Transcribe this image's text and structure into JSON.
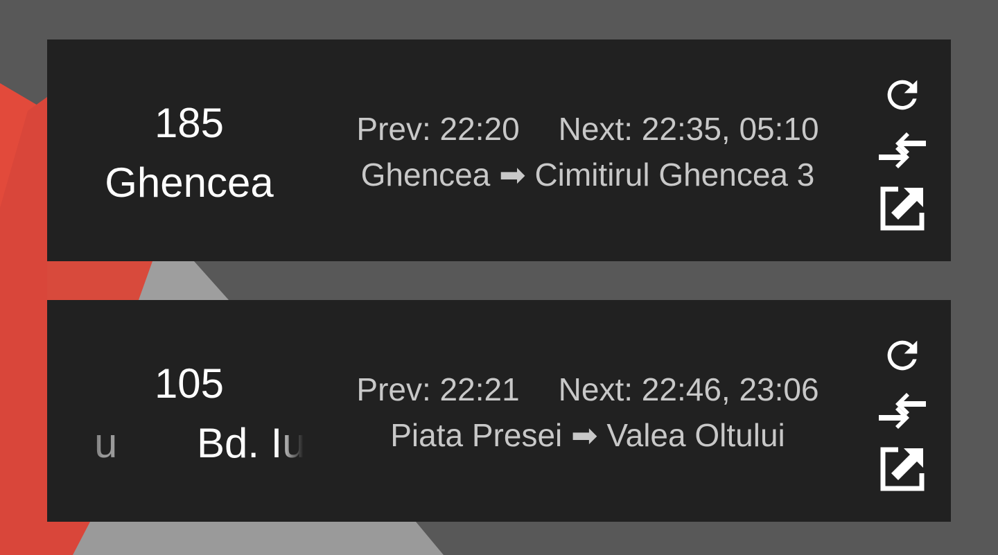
{
  "widgets": [
    {
      "line": "185",
      "stop": "Ghencea",
      "prev": "Prev: 22:20",
      "next": "Next: 22:35, 05:10",
      "route_from": "Ghencea",
      "route_arrow": "➡",
      "route_to": "Cimitirul Ghencea 3"
    },
    {
      "line": "105",
      "stop_ghost": "u",
      "stop": "Bd. Iuli",
      "prev": "Prev: 22:21",
      "next": "Next: 22:46, 23:06",
      "route_from": "Piata Presei",
      "route_arrow": "➡",
      "route_to": "Valea Oltului"
    }
  ],
  "icons": {
    "refresh": "refresh-icon",
    "swap": "swap-direction-icon",
    "open": "open-external-icon"
  },
  "colors": {
    "card_background": "#212121",
    "secondary_text": "#c8c8c8",
    "wallpaper_accent": "#e8493a"
  }
}
